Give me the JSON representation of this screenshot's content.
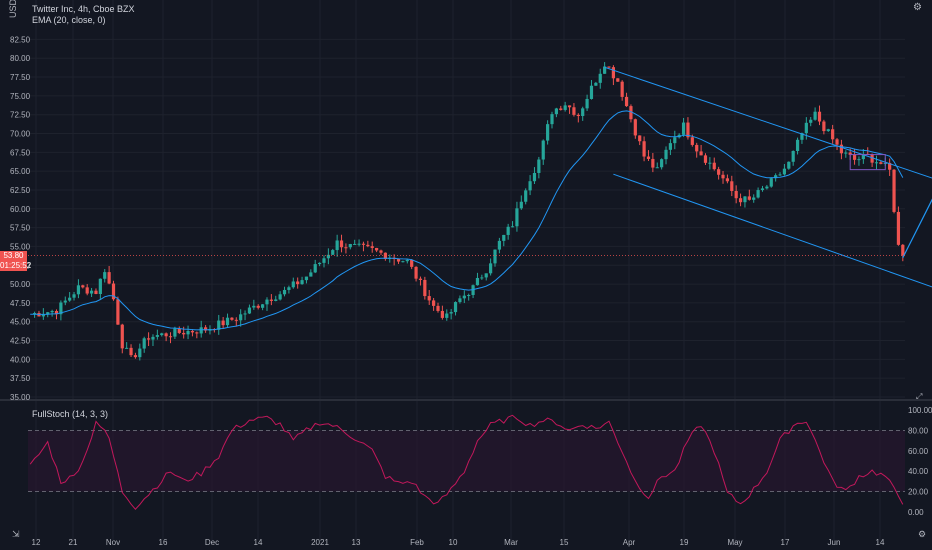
{
  "header": {
    "currency": "USD",
    "symbol": "Twitter Inc, 4h, Cboe BZX",
    "ema_label": "EMA (20, close, 0)"
  },
  "stoch": {
    "label": "FullStoch (14, 3, 3)",
    "ticks": [
      "100.00",
      "80.00",
      "60.00",
      "40.00",
      "20.00",
      "0.00"
    ],
    "upper": 80,
    "lower": 20
  },
  "price_badge": {
    "value": "53.80",
    "countdown": "01:25:52",
    "color": "#f05350"
  },
  "colors": {
    "up": "#26a69a",
    "down": "#ef5350",
    "ema": "#2196f3",
    "drawing": "#2196f3",
    "stoch": "#c2185b"
  },
  "chart_data": {
    "type": "candlestick",
    "y_ticks": [
      "82.50",
      "80.00",
      "77.50",
      "75.00",
      "72.50",
      "70.00",
      "67.50",
      "65.00",
      "62.50",
      "60.00",
      "57.50",
      "55.00",
      "52.50",
      "50.00",
      "47.50",
      "45.00",
      "42.50",
      "40.00",
      "37.50",
      "35.00"
    ],
    "ylim": [
      35,
      83.75
    ],
    "x_labels": [
      "12",
      "21",
      "Nov",
      "16",
      "Dec",
      "14",
      "2021",
      "13",
      "Feb",
      "10",
      "Mar",
      "15",
      "Apr",
      "19",
      "May",
      "17",
      "Jun",
      "14"
    ],
    "close_anchors": [
      [
        0,
        46
      ],
      [
        6,
        46.5
      ],
      [
        11,
        49.5
      ],
      [
        15,
        49
      ],
      [
        17,
        52
      ],
      [
        19,
        48
      ],
      [
        21,
        42
      ],
      [
        23,
        40
      ],
      [
        27,
        43
      ],
      [
        33,
        43.5
      ],
      [
        40,
        44
      ],
      [
        47,
        45.5
      ],
      [
        54,
        48
      ],
      [
        58,
        49
      ],
      [
        63,
        51
      ],
      [
        67,
        53.5
      ],
      [
        70,
        55.5
      ],
      [
        73,
        55
      ],
      [
        78,
        54.5
      ],
      [
        83,
        53.5
      ],
      [
        86,
        53
      ],
      [
        89,
        50
      ],
      [
        92,
        47
      ],
      [
        95,
        45.5
      ],
      [
        98,
        48
      ],
      [
        101,
        49.5
      ],
      [
        104,
        52
      ],
      [
        107,
        55.5
      ],
      [
        110,
        58
      ],
      [
        113,
        63
      ],
      [
        116,
        66.5
      ],
      [
        119,
        73
      ],
      [
        122,
        74
      ],
      [
        125,
        72.5
      ],
      [
        128,
        76
      ],
      [
        131,
        79.5
      ],
      [
        134,
        77
      ],
      [
        137,
        72
      ],
      [
        140,
        67
      ],
      [
        143,
        65
      ],
      [
        146,
        69
      ],
      [
        149,
        71
      ],
      [
        152,
        68
      ],
      [
        155,
        66
      ],
      [
        158,
        64
      ],
      [
        161,
        61.5
      ],
      [
        164,
        61
      ],
      [
        167,
        62.5
      ],
      [
        170,
        64
      ],
      [
        173,
        66
      ],
      [
        176,
        70
      ],
      [
        179,
        72.5
      ],
      [
        182,
        70
      ],
      [
        185,
        67.5
      ],
      [
        188,
        66.5
      ],
      [
        191,
        67
      ],
      [
        194,
        66
      ],
      [
        196,
        65
      ],
      [
        198,
        55
      ],
      [
        199,
        53.8
      ]
    ],
    "ema": {
      "period": 20
    },
    "stoch_anchors": [
      [
        0,
        45
      ],
      [
        4,
        68
      ],
      [
        7,
        30
      ],
      [
        10,
        35
      ],
      [
        13,
        60
      ],
      [
        15,
        90
      ],
      [
        18,
        72
      ],
      [
        21,
        20
      ],
      [
        24,
        5
      ],
      [
        28,
        22
      ],
      [
        32,
        40
      ],
      [
        35,
        30
      ],
      [
        39,
        38
      ],
      [
        43,
        55
      ],
      [
        46,
        80
      ],
      [
        50,
        90
      ],
      [
        54,
        92
      ],
      [
        57,
        86
      ],
      [
        60,
        70
      ],
      [
        63,
        80
      ],
      [
        66,
        88
      ],
      [
        69,
        85
      ],
      [
        72,
        78
      ],
      [
        75,
        70
      ],
      [
        78,
        60
      ],
      [
        81,
        35
      ],
      [
        84,
        28
      ],
      [
        87,
        30
      ],
      [
        90,
        15
      ],
      [
        93,
        8
      ],
      [
        96,
        22
      ],
      [
        99,
        40
      ],
      [
        102,
        70
      ],
      [
        105,
        85
      ],
      [
        108,
        90
      ],
      [
        111,
        93
      ],
      [
        114,
        85
      ],
      [
        117,
        90
      ],
      [
        120,
        88
      ],
      [
        123,
        80
      ],
      [
        126,
        86
      ],
      [
        129,
        82
      ],
      [
        132,
        88
      ],
      [
        135,
        60
      ],
      [
        138,
        30
      ],
      [
        141,
        15
      ],
      [
        144,
        35
      ],
      [
        147,
        40
      ],
      [
        150,
        70
      ],
      [
        153,
        86
      ],
      [
        156,
        60
      ],
      [
        159,
        18
      ],
      [
        162,
        8
      ],
      [
        165,
        22
      ],
      [
        168,
        40
      ],
      [
        171,
        70
      ],
      [
        174,
        85
      ],
      [
        177,
        90
      ],
      [
        180,
        60
      ],
      [
        183,
        30
      ],
      [
        186,
        20
      ],
      [
        189,
        35
      ],
      [
        192,
        40
      ],
      [
        195,
        35
      ],
      [
        197,
        22
      ],
      [
        199,
        10
      ]
    ],
    "channel_upper": [
      [
        131,
        78.8
      ],
      [
        199,
        65.4
      ]
    ],
    "channel_lower": [
      [
        133,
        64.6
      ],
      [
        199,
        51
      ]
    ],
    "projection": [
      [
        199,
        53.5
      ],
      [
        210,
        66.2
      ]
    ]
  }
}
